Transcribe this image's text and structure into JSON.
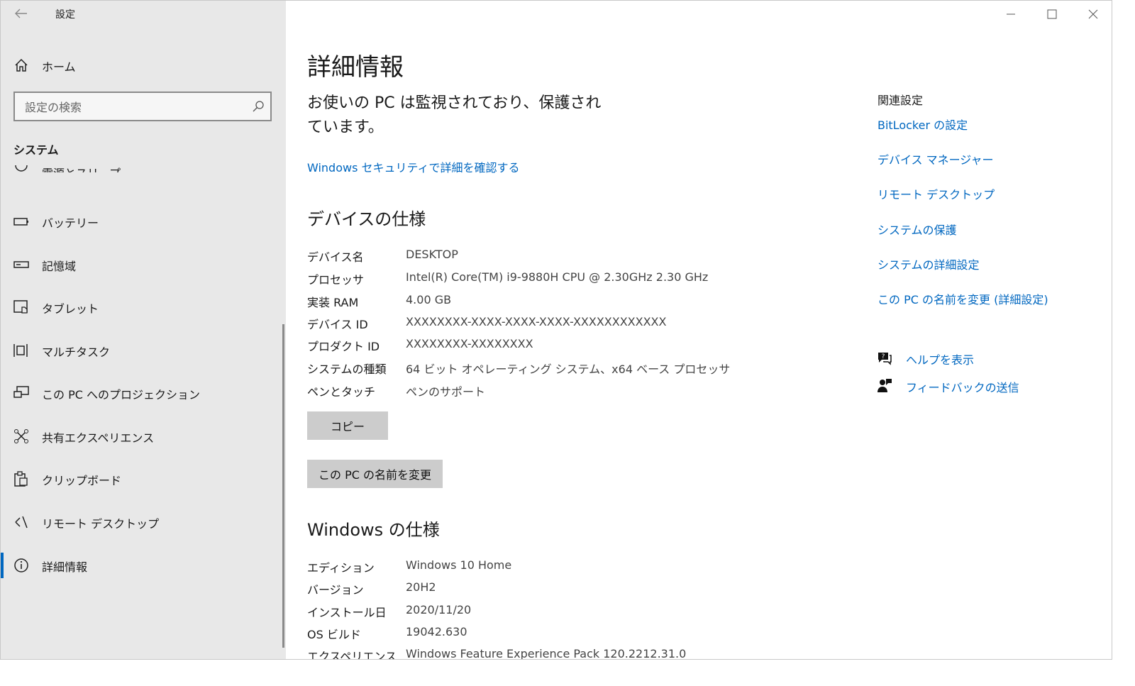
{
  "window": {
    "title": "設定"
  },
  "sidebar": {
    "home_label": "ホーム",
    "search_placeholder": "設定の検索",
    "section_title": "システム",
    "items": [
      {
        "label": "電源とスリープ",
        "icon": "power-icon"
      },
      {
        "label": "バッテリー",
        "icon": "battery-icon"
      },
      {
        "label": "記憶域",
        "icon": "storage-icon"
      },
      {
        "label": "タブレット",
        "icon": "tablet-icon"
      },
      {
        "label": "マルチタスク",
        "icon": "multitask-icon"
      },
      {
        "label": "この PC へのプロジェクション",
        "icon": "projection-icon"
      },
      {
        "label": "共有エクスペリエンス",
        "icon": "shared-experience-icon"
      },
      {
        "label": "クリップボード",
        "icon": "clipboard-icon"
      },
      {
        "label": "リモート デスクトップ",
        "icon": "remote-desktop-icon"
      },
      {
        "label": "詳細情報",
        "icon": "info-icon"
      }
    ]
  },
  "main": {
    "title": "詳細情報",
    "protect_message": "お使いの PC は監視されており、保護されています。",
    "security_link": "Windows セキュリティで詳細を確認する",
    "device_spec": {
      "header": "デバイスの仕様",
      "rows": [
        {
          "key": "デバイス名",
          "value": "DESKTOP"
        },
        {
          "key": "プロセッサ",
          "value": "Intel(R) Core(TM) i9-9880H CPU @ 2.30GHz   2.30 GHz"
        },
        {
          "key": "実装 RAM",
          "value": "4.00 GB"
        },
        {
          "key": "デバイス ID",
          "value": "XXXXXXXX-XXXX-XXXX-XXXX-XXXXXXXXXXXX"
        },
        {
          "key": "プロダクト ID",
          "value": "XXXXXXXX-XXXXXXXX"
        },
        {
          "key": "システムの種類",
          "value": "64 ビット オペレーティング システム、x64 ベース プロセッサ"
        },
        {
          "key": "ペンとタッチ",
          "value": "ペンのサポート"
        }
      ]
    },
    "copy_button": "コピー",
    "rename_button": "この PC の名前を変更",
    "windows_spec": {
      "header": "Windows の仕様",
      "rows": [
        {
          "key": "エディション",
          "value": "Windows 10 Home"
        },
        {
          "key": "バージョン",
          "value": "20H2"
        },
        {
          "key": "インストール日",
          "value": "2020/11/20"
        },
        {
          "key": "OS ビルド",
          "value": "19042.630"
        },
        {
          "key": "エクスペリエンス",
          "value": "Windows Feature Experience Pack 120.2212.31.0"
        }
      ]
    }
  },
  "related": {
    "title": "関連設定",
    "links": [
      "BitLocker の設定",
      "デバイス マネージャー",
      "リモート デスクトップ",
      "システムの保護",
      "システムの詳細設定",
      "この PC の名前を変更 (詳細設定)"
    ],
    "help": {
      "label": "ヘルプを表示",
      "icon": "help-chat-icon"
    },
    "feedback": {
      "label": "フィードバックの送信",
      "icon": "feedback-icon"
    }
  },
  "colors": {
    "accent": "#0067c0",
    "sidebar_bg": "#e8e8e8",
    "button_bg": "#cccccc"
  }
}
